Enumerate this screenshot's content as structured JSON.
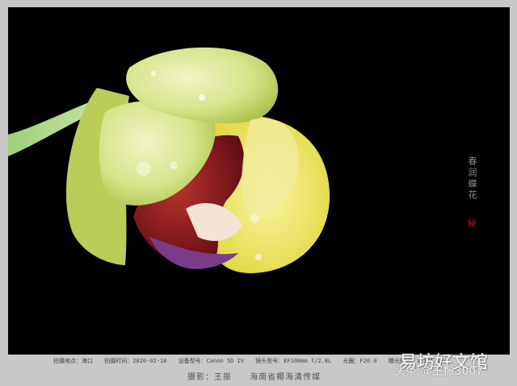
{
  "photo": {
    "subject": "orchid-flower",
    "background_color": "#000000"
  },
  "title_vertical": "春润蝶花",
  "seal_char": "秘",
  "exif": {
    "location": "拍摄地点：海口",
    "date": "拍摄时间：2020-02-18",
    "camera": "设备型号：Canon 5D IV",
    "lens": "镜头型号：EF100mm f/2.8L",
    "aperture": "光圈：F20.0",
    "shutter": "曝光时间：1/125 sec"
  },
  "credit": {
    "photographer": "摄影：王振",
    "organization": "海南省椰海清传媒"
  },
  "watermark": {
    "site": "易坊好文馆",
    "handle": "头条 @王振3007"
  }
}
